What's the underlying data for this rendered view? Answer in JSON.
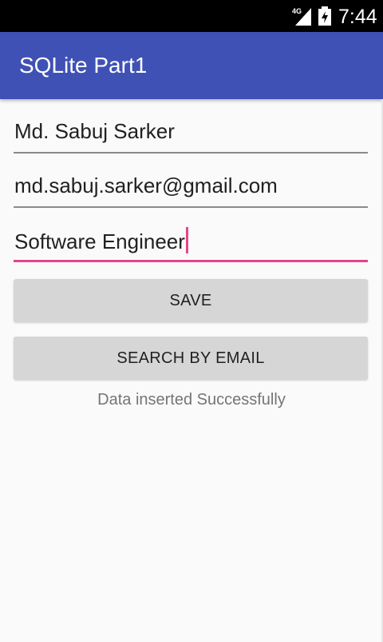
{
  "status_bar": {
    "network_label": "4G",
    "time": "7:44",
    "icons": [
      "signal-icon",
      "battery-charging-icon"
    ]
  },
  "toolbar": {
    "title": "SQLite Part1",
    "color": "#3f51b5"
  },
  "form": {
    "name_value": "Md. Sabuj Sarker",
    "email_value": "md.sabuj.sarker@gmail.com",
    "job_value": "Software Engineer",
    "accent_color": "#e8438a"
  },
  "buttons": {
    "save_label": "SAVE",
    "search_label": "SEARCH BY EMAIL"
  },
  "message": {
    "text": "Data inserted Successfully"
  }
}
